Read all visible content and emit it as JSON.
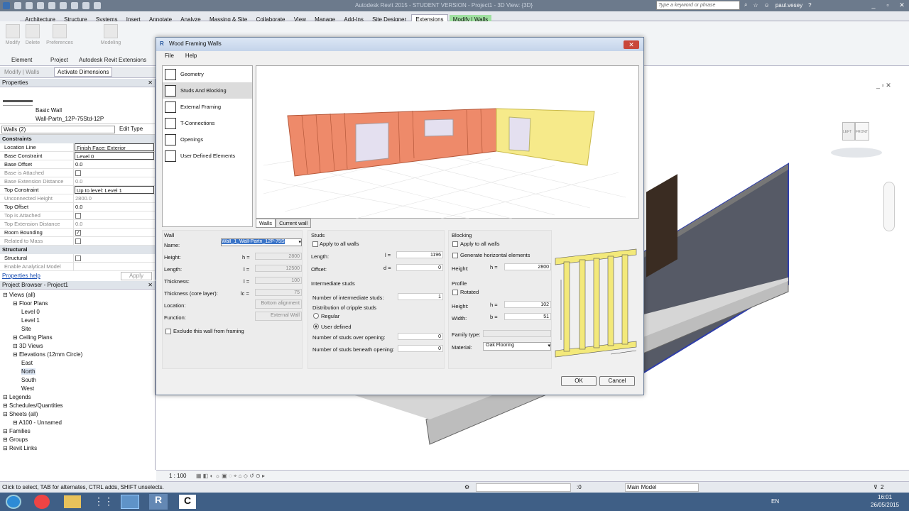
{
  "app": {
    "title": "Autodesk Revit 2015 - STUDENT VERSION -  Project1 - 3D View: {3D}",
    "search_placeholder": "Type a keyword or phrase",
    "user": "paul.vesey"
  },
  "tabs": [
    "Architecture",
    "Structure",
    "Systems",
    "Insert",
    "Annotate",
    "Analyze",
    "Massing & Site",
    "Collaborate",
    "View",
    "Manage",
    "Add-Ins",
    "Site Designer",
    "Extensions",
    "Modify | Walls"
  ],
  "ribbon": {
    "buttons": [
      "Modify",
      "Delete",
      "Preferences",
      "Modeling"
    ],
    "panels": [
      "Element",
      "Project",
      "Autodesk Revit Extensions"
    ],
    "modify_label": "Modify | Walls",
    "activate_dimensions": "Activate Dimensions"
  },
  "properties": {
    "title": "Properties",
    "type_name": "Basic Wall",
    "type_sub": "Wall-Partn_12P-75Std-12P",
    "selector": "Walls (2)",
    "edit_type": "Edit Type",
    "group_constraints": "Constraints",
    "group_structural": "Structural",
    "rows": [
      [
        "Location Line",
        "Finish Face: Exterior"
      ],
      [
        "Base Constraint",
        "Level 0"
      ],
      [
        "Base Offset",
        "0.0"
      ],
      [
        "Base is Attached",
        ""
      ],
      [
        "Base Extension Distance",
        "0.0"
      ],
      [
        "Top Constraint",
        "Up to level: Level 1"
      ],
      [
        "Unconnected Height",
        "2800.0"
      ],
      [
        "Top Offset",
        "0.0"
      ],
      [
        "Top is Attached",
        ""
      ],
      [
        "Top Extension Distance",
        "0.0"
      ],
      [
        "Room Bounding",
        ""
      ],
      [
        "Related to Mass",
        ""
      ]
    ],
    "structural_rows": [
      "Structural",
      "Enable Analytical Model"
    ],
    "help": "Properties help",
    "apply": "Apply"
  },
  "browser": {
    "title": "Project Browser - Project1",
    "items": [
      "Views (all)",
      "Floor Plans",
      "Level 0",
      "Level 1",
      "Site",
      "Ceiling Plans",
      "3D Views",
      "Elevations (12mm Circle)",
      "East",
      "North",
      "South",
      "West",
      "Legends",
      "Schedules/Quantities",
      "Sheets (all)",
      "A100 - Unnamed",
      "Families",
      "Groups",
      "Revit Links"
    ]
  },
  "view": {
    "scale": "1 : 100",
    "cube_left": "LEFT",
    "cube_front": "FRONT"
  },
  "status": {
    "hint": "Click to select, TAB for alternates, CTRL adds, SHIFT unselects.",
    "sel": ":0",
    "model": "Main Model",
    "filter": "2"
  },
  "taskbar": {
    "lang": "EN",
    "time": "16:01",
    "date": "26/05/2015"
  },
  "dialog": {
    "title": "Wood Framing Walls",
    "menu": [
      "File",
      "Help"
    ],
    "categories": [
      "Geometry",
      "Studs And Blocking",
      "External Framing",
      "T-Connections",
      "Openings",
      "User Defined Elements"
    ],
    "view_tabs": [
      "Walls",
      "Current wall"
    ],
    "wall": {
      "section": "Wall",
      "name_label": "Name:",
      "name_value": "Wall_1_Wall-Partn_12P-75S",
      "height_label": "Height:",
      "height_sym": "h =",
      "height": "2800",
      "length_label": "Length:",
      "length_sym": "l =",
      "length": "12500",
      "thickness_label": "Thickness:",
      "thickness_sym": "l =",
      "thickness": "100",
      "core_label": "Thickness (core layer):",
      "core_sym": "lc =",
      "core": "75",
      "location_label": "Location:",
      "location": "Bottom alignment",
      "function_label": "Function:",
      "function": "External Wall",
      "exclude": "Exclude this wall from framing"
    },
    "studs": {
      "section": "Studs",
      "apply": "Apply to all walls",
      "length_label": "Length:",
      "length_sym": "l =",
      "length": "1196",
      "offset_label": "Offset:",
      "offset_sym": "d =",
      "offset": "0"
    },
    "inter": {
      "section": "Intermediate studs",
      "num_label": "Number of intermediate studs:",
      "num": "1",
      "dist_label": "Distribution of cripple studs",
      "regular": "Regular",
      "user": "User defined",
      "over_label": "Number of studs over opening:",
      "over": "0",
      "beneath_label": "Number of studs beneath opening:",
      "beneath": "0"
    },
    "blocking": {
      "section": "Blocking",
      "apply": "Apply to all walls",
      "gen": "Generate horizontal elements",
      "height_label": "Height:",
      "height_sym": "h =",
      "height": "2800"
    },
    "profile": {
      "section": "Profile",
      "rotated": "Rotated",
      "height_label": "Height:",
      "height_sym": "h =",
      "height": "102",
      "width_label": "Width:",
      "width_sym": "b =",
      "width": "51",
      "family_label": "Family type:",
      "family": "",
      "material_label": "Material:",
      "material": "Oak Flooring"
    },
    "ok": "OK",
    "cancel": "Cancel"
  }
}
